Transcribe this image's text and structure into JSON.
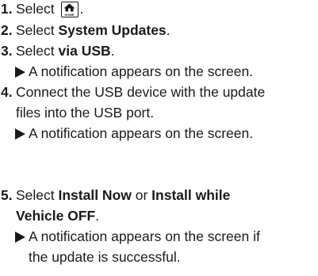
{
  "steps": [
    {
      "number": "1.",
      "text_before": "Select ",
      "icon": "home-button-icon",
      "icon_caption": "HOME",
      "text_after": "."
    },
    {
      "number": "2.",
      "text_before": "Select ",
      "bold": "System Updates",
      "text_after": "."
    },
    {
      "number": "3.",
      "text_before": "Select ",
      "bold": "via USB",
      "text_after": ".",
      "result": "A notification appears on the screen."
    },
    {
      "number": "4.",
      "line1": "Connect the USB device with the update",
      "line2": "files into the USB port.",
      "result": "A notification appears on the screen."
    },
    {
      "number": "5.",
      "text_before": "Select ",
      "bold1": "Install Now",
      "middle": " or ",
      "bold2": "Install while",
      "bold2_line2": "Vehicle OFF",
      "text_after": ".",
      "result_line1": "A notification appears on the screen if",
      "result_line2": "the update is successful."
    }
  ],
  "colors": {
    "text": "#1a1a1a",
    "background": "#ffffff"
  }
}
